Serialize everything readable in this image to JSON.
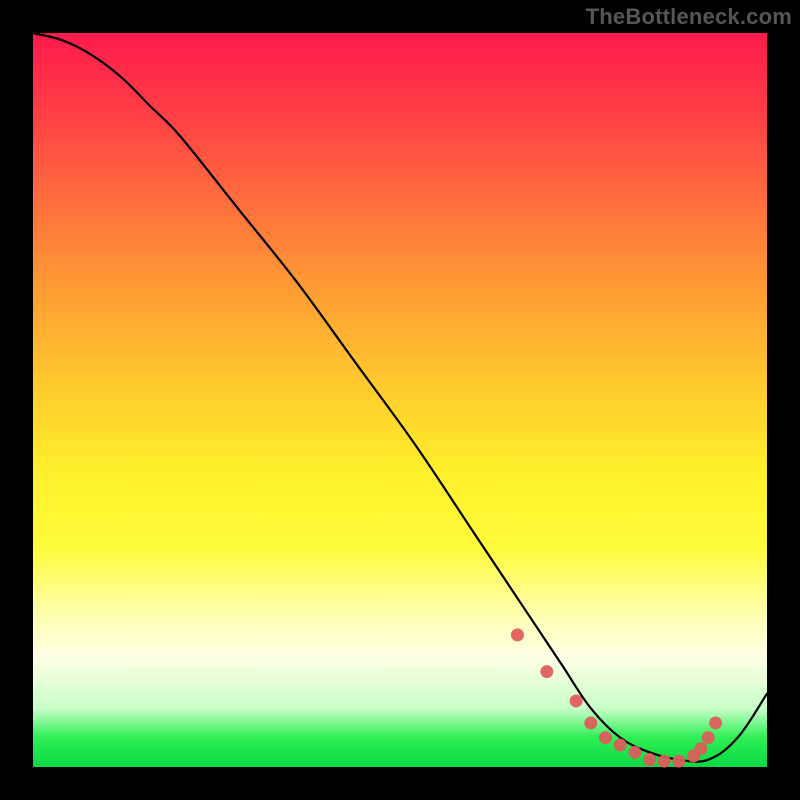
{
  "watermark": "TheBottleneck.com",
  "palette": {
    "bg": "#000000",
    "dot": "#e05a5a",
    "curve": "#000000"
  },
  "chart_data": {
    "type": "line",
    "title": "",
    "xlabel": "",
    "ylabel": "",
    "xlim": [
      0,
      100
    ],
    "ylim": [
      0,
      100
    ],
    "grid": false,
    "legend": false,
    "series": [
      {
        "name": "bottleneck-curve",
        "x": [
          0,
          4,
          8,
          12,
          16,
          20,
          28,
          36,
          44,
          52,
          60,
          64,
          68,
          72,
          76,
          80,
          84,
          88,
          92,
          96,
          100
        ],
        "y": [
          100,
          99,
          97,
          94,
          90,
          86,
          76,
          66,
          55,
          44,
          32,
          26,
          20,
          14,
          8,
          4,
          2,
          1,
          1,
          4,
          10
        ]
      }
    ],
    "valley_markers": {
      "name": "valley-dots",
      "x": [
        66,
        70,
        74,
        76,
        78,
        80,
        82,
        84,
        86,
        88,
        90,
        91,
        92,
        93
      ],
      "y": [
        18,
        13,
        9,
        6,
        4,
        3,
        2,
        1,
        0.8,
        0.8,
        1.5,
        2.5,
        4,
        6
      ]
    }
  }
}
